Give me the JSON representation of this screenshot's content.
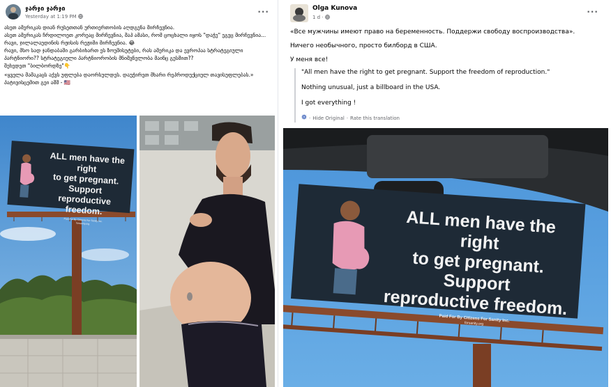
{
  "left_post": {
    "author": "ჯარჯი ჯარჯი",
    "timestamp": "Yesterday at 1:19 PM",
    "lines": [
      "ასეთ ამერიკას დიან რუსეთთან ურთიერთობის აღდგენა მირჩევნია.",
      "ასეთ ამერიკას ჩრდილოეთ კორეაც მირჩევნია, შაპ ამასი, რომ ცოცხალი იყოს \"დაჭე\" ეგეც მირჩევნია... რავი, ჯილალაუდინის რჟისის რეჟიმი მირჩევნია. 😂",
      "რავი, მსო სად ჯანდაბაში გარბიხართ ეს ზოუშისუტები, რას ამერიკა და ევროპაა სტრატეგიული პარტნიორი?? სტრატეგიული პარტნიორობის მნიშვნელობა მაინც გესმით??",
      "შეხედეთ \"ბილბორდზე\"👇",
      "«ყველა მამაკაცს აქვს უფლება დაორსულდეს. დაუჭირეთ მხარი რეპროდუქციულ თავისუფლებას.»",
      "პატივისცემით  გეი აშშ - 🇺🇸"
    ]
  },
  "right_post": {
    "author": "Olga Kunova",
    "timestamp": "1 d · ",
    "original_lines": [
      "«Все мужчины имеют право на беременность. Поддержи свободу воспроизводства».",
      "Ничего необычного, просто билборд в США.",
      "У меня все!"
    ],
    "translated_lines": [
      "\"All men have the right to get pregnant. Support the freedom of reproduction.\"",
      "Nothing unusual, just a billboard in the USA.",
      "I got everything !"
    ],
    "hide_original": "Hide Original",
    "rate": "Rate this translation",
    "separator": " · "
  },
  "billboard": {
    "line1": "ALL men have the right",
    "line2": "to get pregnant. Support",
    "line3": "reproductive freedom.",
    "paid_by": "Paid For By Citizens For Sanity Inc.",
    "site": "forsanity.org"
  },
  "icons": {
    "more": "more-icon",
    "globe": "globe-icon",
    "gear": "gear-icon"
  },
  "colors": {
    "billboard_bg": "#1e2a36",
    "sky": "#5c9bd6",
    "secondary_text": "#65676b"
  }
}
